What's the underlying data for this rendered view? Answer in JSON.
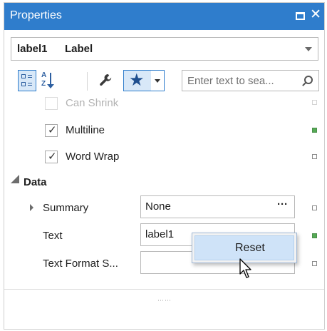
{
  "window": {
    "title": "Properties"
  },
  "selector": {
    "name": "label1",
    "type": "Label"
  },
  "search": {
    "placeholder": "Enter text to sea..."
  },
  "rows": [
    {
      "label": "Can Shrink",
      "checked": false,
      "dimmed": true
    },
    {
      "label": "Multiline",
      "checked": true,
      "modified": true
    },
    {
      "label": "Word Wrap",
      "checked": true,
      "modified": false
    }
  ],
  "category": {
    "name": "Data",
    "expanded": true
  },
  "properties": [
    {
      "label": "Summary",
      "value": "None",
      "expandable": true,
      "modified": false
    },
    {
      "label": "Text",
      "value": "label1",
      "modified": true
    },
    {
      "label": "Text Format S...",
      "value": "",
      "modified": false
    }
  ],
  "context_menu": {
    "item": "Reset"
  },
  "icons": {
    "categorized": "categorized-view-icon",
    "alphabetical": "sort-alphabetical-icon",
    "wrench": "wrench-icon",
    "star": "favorites-star-icon",
    "search": "search-icon",
    "close": "close-icon",
    "maximize": "maximize-icon"
  },
  "colors": {
    "title_bar": "#2f7dcc",
    "modified_marker": "#55aa55",
    "menu_highlight": "#cfe3f8"
  }
}
